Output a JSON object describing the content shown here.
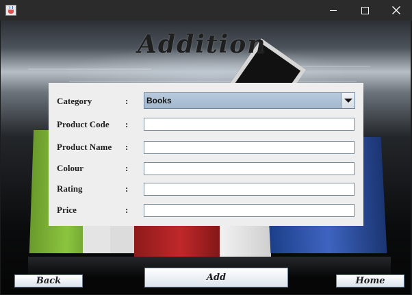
{
  "window": {
    "title": "",
    "controls": {
      "minimize_icon": "minimize-icon",
      "maximize_icon": "maximize-icon",
      "close_icon": "close-icon"
    }
  },
  "heading": "Addition",
  "form": {
    "category": {
      "label": "Category",
      "colon": ":",
      "selected": "Books"
    },
    "product_code": {
      "label": "Product Code",
      "colon": ":",
      "value": ""
    },
    "product_name": {
      "label": "Product Name",
      "colon": ":",
      "value": ""
    },
    "colour": {
      "label": "Colour",
      "colon": ":",
      "value": ""
    },
    "rating": {
      "label": "Rating",
      "colon": ":",
      "value": ""
    },
    "price": {
      "label": "Price",
      "colon": ":",
      "value": ""
    }
  },
  "buttons": {
    "back": "Back",
    "add": "Add",
    "home": "Home"
  },
  "colors": {
    "combo_fill": "#a3b8ce",
    "panel": "#eeeeee",
    "titlebar": "#2b2b2b"
  }
}
